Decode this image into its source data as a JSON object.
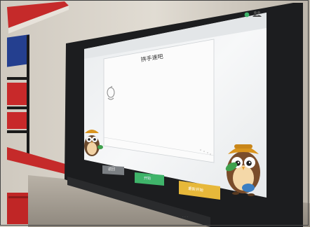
{
  "scene": {
    "description_type": "photo-of-smart-board",
    "accent_colors": {
      "wall": "#d8d2c8",
      "red_stripe": "#c9292b",
      "blue_stripe": "#1f3b8c",
      "bezel": "#1d1e20",
      "screen": "#f3f5f6",
      "green_button": "#3fb46a",
      "orange_button": "#e7b83a",
      "gray_button": "#7b7f83"
    }
  },
  "screen": {
    "title": "拼手速吧",
    "status_icons": [
      "green-dot-icon",
      "user-group-icon"
    ],
    "buttons": [
      {
        "label": "返回"
      },
      {
        "label": "开始"
      },
      {
        "label": "重新开始"
      }
    ]
  }
}
